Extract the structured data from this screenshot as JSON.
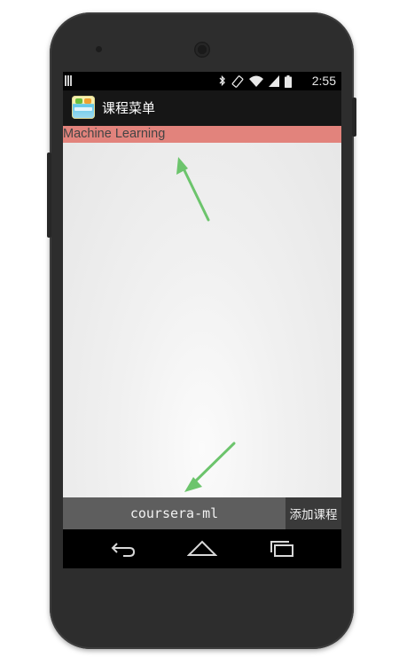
{
  "status_bar": {
    "time": "2:55",
    "icons": [
      "notification-bars-icon",
      "bluetooth-icon",
      "rotate-icon",
      "wifi-icon",
      "signal-icon",
      "battery-icon"
    ]
  },
  "action_bar": {
    "app_icon": "app-launcher-icon",
    "title": "课程菜单"
  },
  "course_list": {
    "items": [
      {
        "label": "Machine Learning",
        "highlight_color": "#e2837c"
      }
    ]
  },
  "input_row": {
    "input_value": "coursera-ml",
    "add_button_label": "添加课程"
  },
  "nav_bar": {
    "buttons": [
      "back-icon",
      "home-icon",
      "recent-apps-icon"
    ]
  },
  "annotations": {
    "arrow_color": "#6cc46c"
  }
}
